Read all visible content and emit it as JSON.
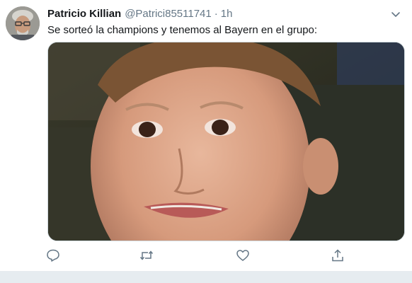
{
  "tweet": {
    "author_name": "Patricio Killian",
    "author_handle": "@Patrici85511741",
    "separator": "·",
    "timestamp": "1h",
    "text": "Se sorteó la champions y tenemos al Bayern en el grupo:",
    "avatar_icon": "user-avatar",
    "media_type": "photo",
    "actions": [
      {
        "icon": "reply-icon"
      },
      {
        "icon": "retweet-icon"
      },
      {
        "icon": "like-icon"
      },
      {
        "icon": "share-icon"
      }
    ],
    "menu_icon": "chevron-down-icon"
  },
  "colors": {
    "text": "#14171a",
    "secondary": "#657786",
    "icon": "#657786",
    "border": "#cfd9de",
    "footer_bg": "#e6ecf0"
  }
}
